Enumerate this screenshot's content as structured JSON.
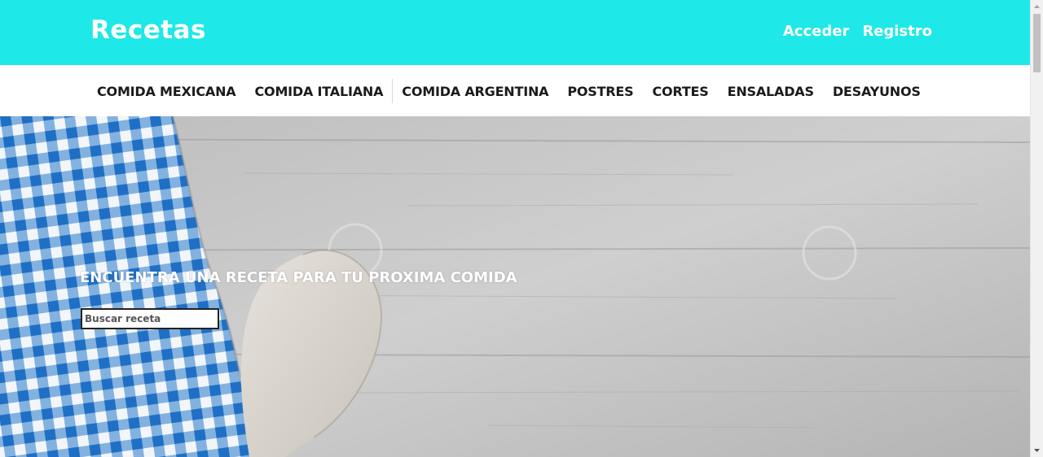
{
  "header": {
    "logo": "Recetas",
    "login_label": "Acceder",
    "register_label": "Registro"
  },
  "nav": {
    "items": [
      {
        "label": "COMIDA MEXICANA"
      },
      {
        "label": "COMIDA ITALIANA"
      },
      {
        "label": "COMIDA ARGENTINA"
      },
      {
        "label": "POSTRES"
      },
      {
        "label": "CORTES"
      },
      {
        "label": "ENSALADAS"
      },
      {
        "label": "DESAYUNOS"
      }
    ]
  },
  "hero": {
    "title": "ENCUENTRA UNA RECETA PARA TU PROXIMA COMIDA",
    "search_placeholder": "Buscar receta",
    "image_icon": "tablecloth-wooden-spoon-photo"
  },
  "colors": {
    "header_bg": "#1fe8e8",
    "header_text": "#ffffff",
    "nav_text": "#1b1b1b"
  }
}
